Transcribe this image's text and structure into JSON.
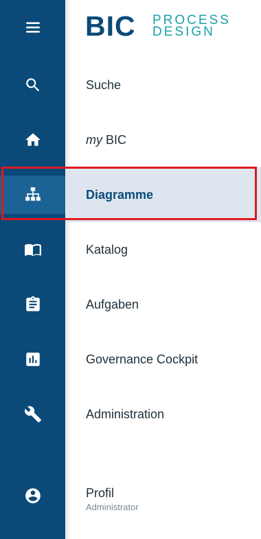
{
  "logo": {
    "wordmark": "BIC",
    "line1": "PROCESS",
    "line2": "DESIGN"
  },
  "rail": {
    "menu_icon": "hamburger-menu-icon",
    "items": [
      {
        "icon": "search-icon"
      },
      {
        "icon": "home-icon"
      },
      {
        "icon": "sitemap-diagram-icon",
        "active": true
      },
      {
        "icon": "book-open-icon"
      },
      {
        "icon": "clipboard-icon"
      },
      {
        "icon": "bar-chart-icon"
      },
      {
        "icon": "wrench-icon"
      },
      {
        "icon": "account-circle-icon"
      }
    ]
  },
  "nav": {
    "search": {
      "label": "Suche"
    },
    "mybic": {
      "prefix": "my",
      "label": " BIC"
    },
    "diagrams": {
      "label": "Diagramme",
      "active": true
    },
    "catalog": {
      "label": "Katalog"
    },
    "tasks": {
      "label": "Aufgaben"
    },
    "governance": {
      "label": "Governance Cockpit"
    },
    "administration": {
      "label": "Administration"
    },
    "profile": {
      "label": "Profil",
      "role": "Administrator"
    }
  },
  "colors": {
    "rail": "#0b4a78",
    "rail_active": "#1b6394",
    "active_row": "#dde6ee",
    "highlight_border": "#e0171f",
    "logo_teal": "#1aa0a8"
  }
}
